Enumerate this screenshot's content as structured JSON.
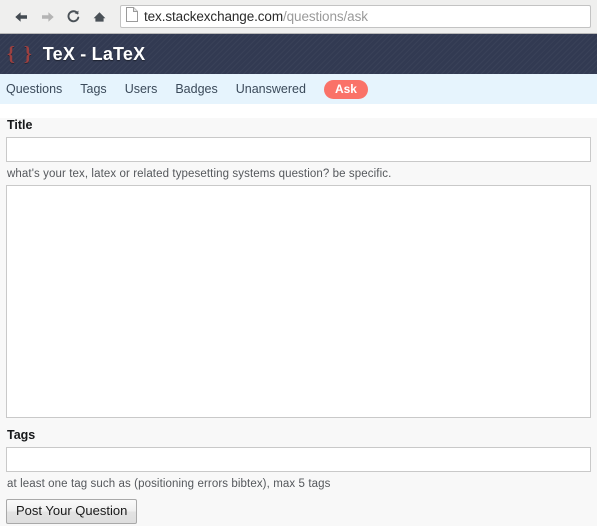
{
  "browser": {
    "back_icon": "back-arrow-icon",
    "forward_icon": "forward-arrow-icon",
    "reload_icon": "reload-icon",
    "home_icon": "home-icon",
    "page_icon": "page-document-icon",
    "url_host": "tex.stackexchange.com",
    "url_path": "/questions/ask"
  },
  "site": {
    "logo_braces": "{ }",
    "title": "TeX - LaTeX",
    "header_color": "#323a52",
    "nav_background": "#e6f4fd",
    "accent_color": "#fa7268",
    "nav": [
      {
        "label": "Questions"
      },
      {
        "label": "Tags"
      },
      {
        "label": "Users"
      },
      {
        "label": "Badges"
      },
      {
        "label": "Unanswered"
      }
    ],
    "ask_button_label": "Ask"
  },
  "form": {
    "title_label": "Title",
    "title_value": "",
    "title_placeholder": "",
    "title_hint": "what's your tex, latex or related typesetting systems question? be specific.",
    "body_value": "",
    "body_placeholder": "",
    "tags_label": "Tags",
    "tags_value": "",
    "tags_placeholder": "",
    "tags_hint": "at least one tag such as (positioning errors bibtex), max 5 tags",
    "submit_label": "Post Your Question"
  }
}
